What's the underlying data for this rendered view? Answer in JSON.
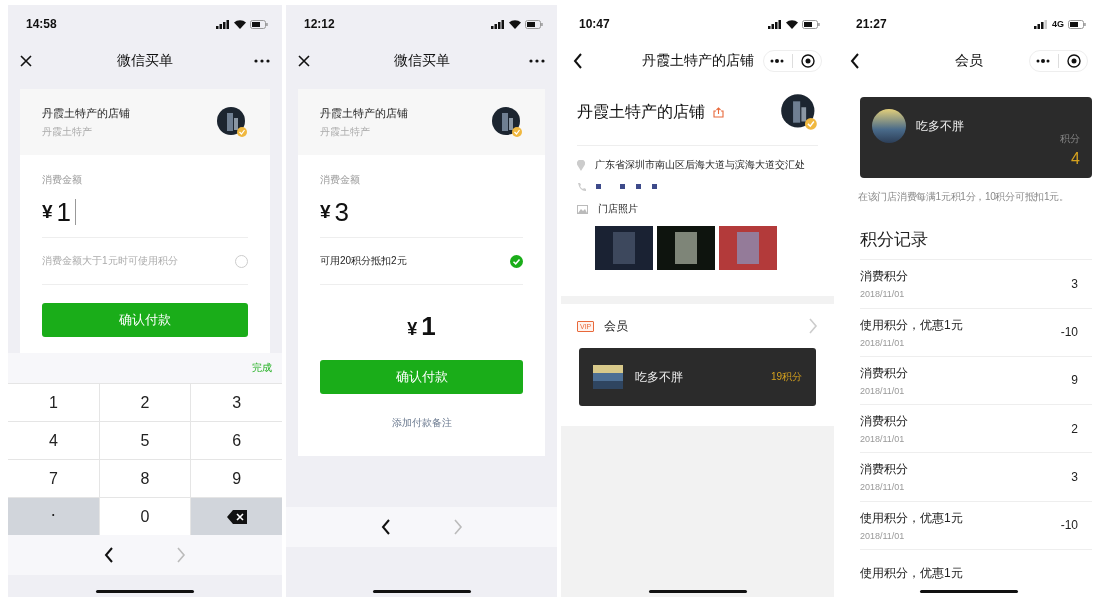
{
  "screens": [
    {
      "kind": "pay",
      "status": {
        "time": "14:58"
      },
      "nav": {
        "title": "微信买单"
      },
      "shop": {
        "name": "丹霞土特产的店铺",
        "subtitle": "丹霞土特产"
      },
      "amount_label": "消费金额",
      "currency": "¥",
      "amount": "1",
      "amount_focused": true,
      "points_option": {
        "text": "消费金额大于1元时可使用积分",
        "checked": false,
        "disabled": true
      },
      "confirm_button": "确认付款",
      "keyboard": {
        "done": "完成",
        "keys": [
          {
            "kind": "digit",
            "label": "1"
          },
          {
            "kind": "digit",
            "label": "2"
          },
          {
            "kind": "digit",
            "label": "3"
          },
          {
            "kind": "digit",
            "label": "4"
          },
          {
            "kind": "digit",
            "label": "5"
          },
          {
            "kind": "digit",
            "label": "6"
          },
          {
            "kind": "digit",
            "label": "7"
          },
          {
            "kind": "digit",
            "label": "8"
          },
          {
            "kind": "digit",
            "label": "9"
          },
          {
            "kind": "symbol",
            "label": "."
          },
          {
            "kind": "digit",
            "label": "0"
          },
          {
            "kind": "backspace"
          }
        ]
      }
    },
    {
      "kind": "pay",
      "status": {
        "time": "12:12"
      },
      "nav": {
        "title": "微信买单"
      },
      "shop": {
        "name": "丹霞土特产的店铺",
        "subtitle": "丹霞土特产"
      },
      "amount_label": "消费金额",
      "currency": "¥",
      "amount": "3",
      "amount_focused": false,
      "points_option": {
        "text": "可用20积分抵扣2元",
        "checked": true,
        "disabled": false
      },
      "total": {
        "currency": "¥",
        "amount": "1"
      },
      "confirm_button": "确认付款",
      "note_link": "添加付款备注"
    },
    {
      "kind": "store",
      "status": {
        "time": "10:47"
      },
      "nav": {
        "title": "丹霞土特产的店铺"
      },
      "store_name": "丹霞土特产的店铺",
      "address": "广东省深圳市南山区后海大道与滨海大道交汇处",
      "photos_label": "门店照片",
      "photos": [
        {
          "kind": "city"
        },
        {
          "kind": "stadium"
        },
        {
          "kind": "players"
        }
      ],
      "member_section": {
        "tag": "VIP",
        "title": "会员",
        "card": {
          "name": "吃多不胖",
          "points": "19积分"
        }
      }
    },
    {
      "kind": "member",
      "status": {
        "time": "21:27",
        "network": "4G"
      },
      "nav": {
        "title": "会员"
      },
      "card": {
        "name": "吃多不胖",
        "points_label": "积分",
        "points": "4"
      },
      "rule": "在该门店消费每满1元积1分，10积分可抵扣1元。",
      "records_title": "积分记录",
      "records": [
        {
          "title": "消费积分",
          "date": "2018/11/01",
          "value": "3"
        },
        {
          "title": "使用积分，优惠1元",
          "date": "2018/11/01",
          "value": "-10"
        },
        {
          "title": "消费积分",
          "date": "2018/11/01",
          "value": "9"
        },
        {
          "title": "消费积分",
          "date": "2018/11/01",
          "value": "2"
        },
        {
          "title": "消费积分",
          "date": "2018/11/01",
          "value": "3"
        },
        {
          "title": "使用积分，优惠1元",
          "date": "2018/11/01",
          "value": "-10"
        },
        {
          "title": "使用积分，优惠1元"
        }
      ]
    }
  ]
}
